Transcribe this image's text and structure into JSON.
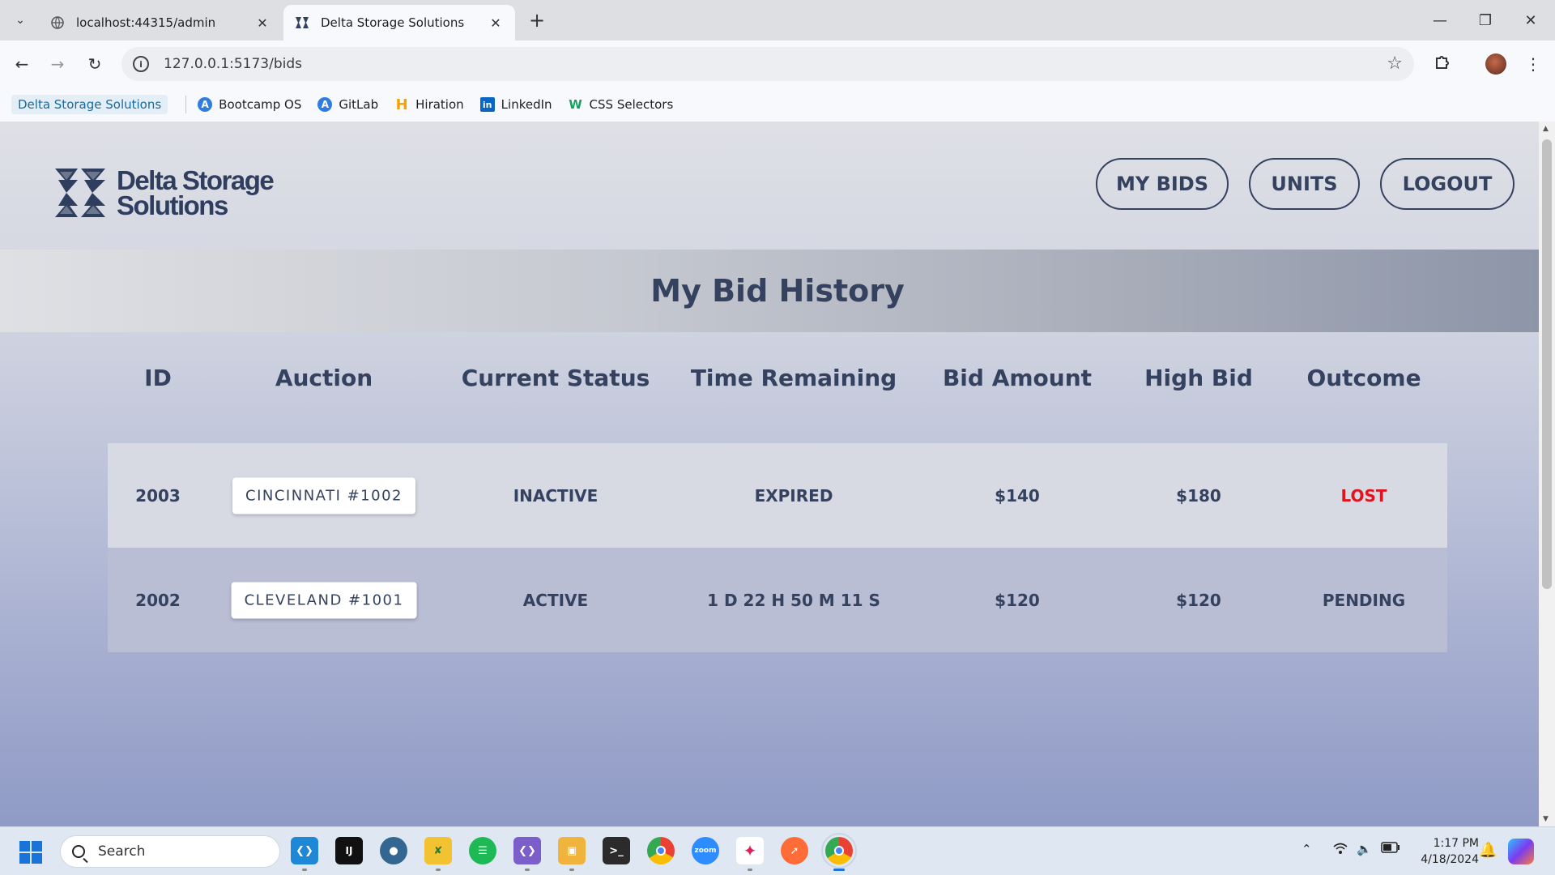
{
  "browser": {
    "tabs": [
      {
        "title": "localhost:44315/admin",
        "active": false
      },
      {
        "title": "Delta Storage Solutions",
        "active": true
      }
    ],
    "url": "127.0.0.1:5173/bids",
    "bookmarks": [
      {
        "label": "Delta Storage Solutions",
        "icon": "none"
      },
      {
        "label": "Bootcamp OS",
        "icon": "atom-icon"
      },
      {
        "label": "GitLab",
        "icon": "atom-icon"
      },
      {
        "label": "Hiration",
        "icon": "h-icon"
      },
      {
        "label": "LinkedIn",
        "icon": "linkedin-icon"
      },
      {
        "label": "CSS Selectors",
        "icon": "w-icon"
      }
    ]
  },
  "site": {
    "logo": {
      "line1": "Delta Storage",
      "line2": "Solutions"
    },
    "nav": {
      "my_bids": "MY BIDS",
      "units": "UNITS",
      "logout": "LOGOUT"
    },
    "page_title": "My Bid History",
    "columns": [
      "ID",
      "Auction",
      "Current Status",
      "Time Remaining",
      "Bid Amount",
      "High Bid",
      "Outcome"
    ],
    "rows": [
      {
        "id": "2003",
        "auction": "CINCINNATI #1002",
        "status": "INACTIVE",
        "time_remaining": "EXPIRED",
        "bid_amount": "$140",
        "high_bid": "$180",
        "outcome": "LOST"
      },
      {
        "id": "2002",
        "auction": "CLEVELAND #1001",
        "status": "ACTIVE",
        "time_remaining": "1 D 22 H 50 M 11 S",
        "bid_amount": "$120",
        "high_bid": "$120",
        "outcome": "PENDING"
      }
    ],
    "colors": {
      "primary": "#34425f",
      "lost": "#e0141e"
    }
  },
  "taskbar": {
    "search_placeholder": "Search",
    "time": "1:17 PM",
    "date": "4/18/2024"
  }
}
